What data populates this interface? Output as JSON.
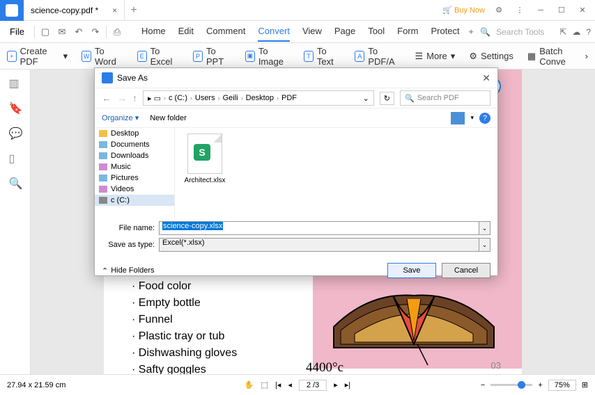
{
  "titlebar": {
    "tab_name": "science-copy.pdf *",
    "buy_now": "Buy Now"
  },
  "menubar": {
    "file": "File",
    "tabs": [
      "Home",
      "Edit",
      "Comment",
      "Convert",
      "View",
      "Page",
      "Tool",
      "Form",
      "Protect"
    ],
    "active_index": 3,
    "search_placeholder": "Search Tools"
  },
  "toolbar": {
    "items": [
      "Create PDF",
      "To Word",
      "To Excel",
      "To PPT",
      "To Image",
      "To Text",
      "To PDF/A",
      "More",
      "Settings",
      "Batch Conve"
    ]
  },
  "doc": {
    "list": [
      "Food color",
      "Empty bottle",
      "Funnel",
      "Plastic tray or tub",
      "Dishwashing gloves",
      "Safty goggles"
    ],
    "temp": "4400°c",
    "page_num": "03"
  },
  "dialog": {
    "title": "Save As",
    "breadcrumb": [
      "c (C:)",
      "Users",
      "Geili",
      "Desktop",
      "PDF"
    ],
    "search_placeholder": "Search PDF",
    "organize": "Organize",
    "new_folder": "New folder",
    "tree": [
      "Desktop",
      "Documents",
      "Downloads",
      "Music",
      "Pictures",
      "Videos",
      "c (C:)"
    ],
    "file_item": "Architect.xlsx",
    "filename_label": "File name:",
    "filename_value": "science-copy.xlsx",
    "type_label": "Save as type:",
    "type_value": "Excel(*.xlsx)",
    "hide_folders": "Hide Folders",
    "save": "Save",
    "cancel": "Cancel"
  },
  "statusbar": {
    "dims": "27.94 x 21.59 cm",
    "page": "2 /3",
    "zoom": "75%"
  }
}
